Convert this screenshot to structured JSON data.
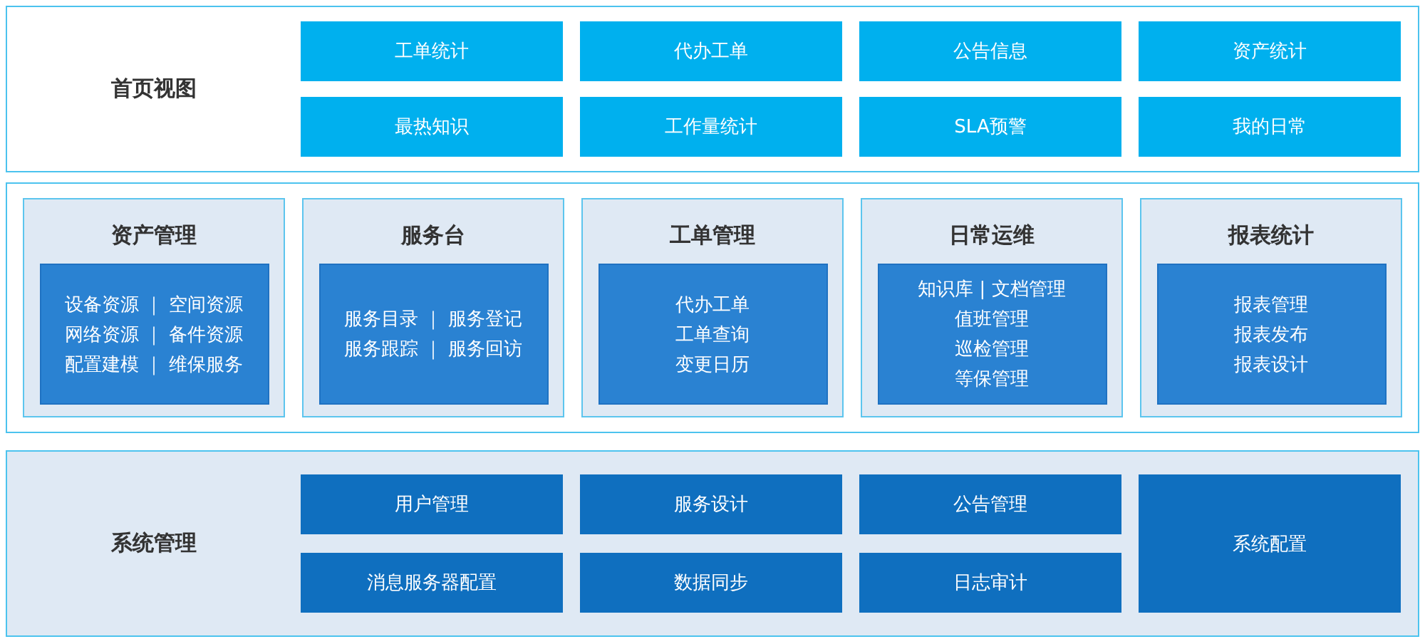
{
  "home_view": {
    "title": "首页视图",
    "buttons": [
      {
        "label": "工单统计"
      },
      {
        "label": "代办工单"
      },
      {
        "label": "公告信息"
      },
      {
        "label": "资产统计"
      },
      {
        "label": "最热知识"
      },
      {
        "label": "工作量统计"
      },
      {
        "label": "SLA预警"
      },
      {
        "label": "我的日常"
      }
    ]
  },
  "modules": [
    {
      "title": "资产管理",
      "lines": [
        "设备资源 ｜ 空间资源",
        "网络资源 ｜ 备件资源",
        "配置建模 ｜ 维保服务"
      ]
    },
    {
      "title": "服务台",
      "lines": [
        "服务目录 ｜ 服务登记",
        "服务跟踪 ｜ 服务回访"
      ]
    },
    {
      "title": "工单管理",
      "lines": [
        "代办工单",
        "工单查询",
        "变更日历"
      ]
    },
    {
      "title": "日常运维",
      "lines": [
        "知识库 | 文档管理",
        "值班管理",
        "巡检管理",
        "等保管理"
      ]
    },
    {
      "title": "报表统计",
      "lines": [
        "报表管理",
        "报表发布",
        "报表设计"
      ]
    }
  ],
  "system_management": {
    "title": "系统管理",
    "buttons": [
      {
        "label": "用户管理",
        "kind": "normal"
      },
      {
        "label": "服务设计",
        "kind": "normal"
      },
      {
        "label": "公告管理",
        "kind": "normal"
      },
      {
        "label": "系统配置",
        "kind": "tall"
      },
      {
        "label": "消息服务器配置",
        "kind": "normal"
      },
      {
        "label": "数据同步",
        "kind": "normal"
      },
      {
        "label": "日志审计",
        "kind": "normal"
      }
    ]
  }
}
